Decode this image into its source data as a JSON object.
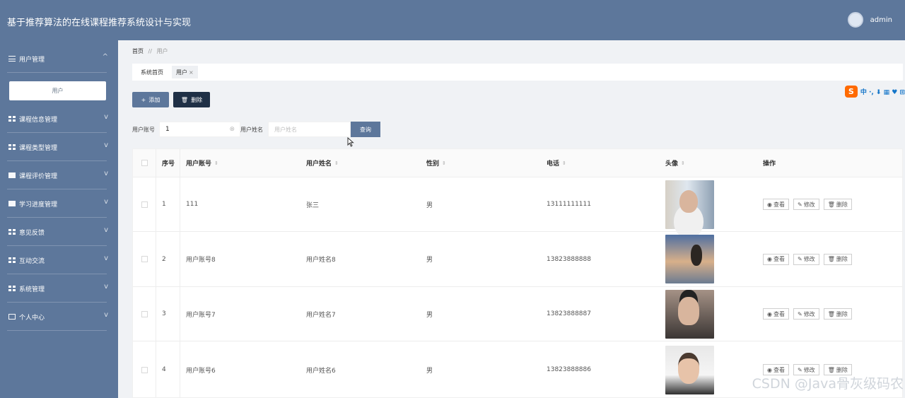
{
  "header": {
    "title": "基于推荐算法的在线课程推荐系统设计与实现",
    "username": "admin"
  },
  "sidebar": {
    "items": [
      {
        "label": "用户管理",
        "icon": "sliders-icon",
        "chevron": "^",
        "sub": "用户"
      },
      {
        "label": "课程信息管理",
        "icon": "grid-icon",
        "chevron": "v"
      },
      {
        "label": "课程类型管理",
        "icon": "grid-icon",
        "chevron": "v"
      },
      {
        "label": "课程评价管理",
        "icon": "clipboard-icon",
        "chevron": "v"
      },
      {
        "label": "学习进度管理",
        "icon": "chart-icon",
        "chevron": "v"
      },
      {
        "label": "意见反馈",
        "icon": "grid-icon",
        "chevron": "v"
      },
      {
        "label": "互动交流",
        "icon": "grid-icon",
        "chevron": "v"
      },
      {
        "label": "系统管理",
        "icon": "grid-icon",
        "chevron": "v"
      },
      {
        "label": "个人中心",
        "icon": "window-icon",
        "chevron": "v"
      }
    ]
  },
  "breadcrumb": {
    "home": "首页",
    "sep": "//",
    "current": "用户"
  },
  "tabs": [
    {
      "label": "系统首页"
    },
    {
      "label": "用户",
      "close": "×"
    }
  ],
  "actions": {
    "add": "添加",
    "delete": "删除"
  },
  "search": {
    "account_label": "用户账号",
    "account_value": "1",
    "name_label": "用户姓名",
    "name_placeholder": "用户姓名",
    "query": "查询"
  },
  "table": {
    "headers": {
      "no": "序号",
      "account": "用户账号",
      "name": "用户姓名",
      "sex": "性别",
      "phone": "电话",
      "avatar": "头像",
      "ops": "操作"
    },
    "rows": [
      {
        "no": "1",
        "account": "111",
        "name": "张三",
        "sex": "男",
        "phone": "13111111111"
      },
      {
        "no": "2",
        "account": "用户账号8",
        "name": "用户姓名8",
        "sex": "男",
        "phone": "13823888888"
      },
      {
        "no": "3",
        "account": "用户账号7",
        "name": "用户姓名7",
        "sex": "男",
        "phone": "13823888887"
      },
      {
        "no": "4",
        "account": "用户账号6",
        "name": "用户姓名6",
        "sex": "男",
        "phone": "13823888886"
      }
    ],
    "op_labels": {
      "view": "查看",
      "edit": "修改",
      "delete": "删除"
    }
  },
  "ime": {
    "logo": "S",
    "text": "中 ·, ⬇ ▦ ♥ ⊞"
  },
  "watermark": "CSDN @Java骨灰级码农",
  "colors": {
    "primary": "#5d779b",
    "dark_button": "#1f3046"
  }
}
